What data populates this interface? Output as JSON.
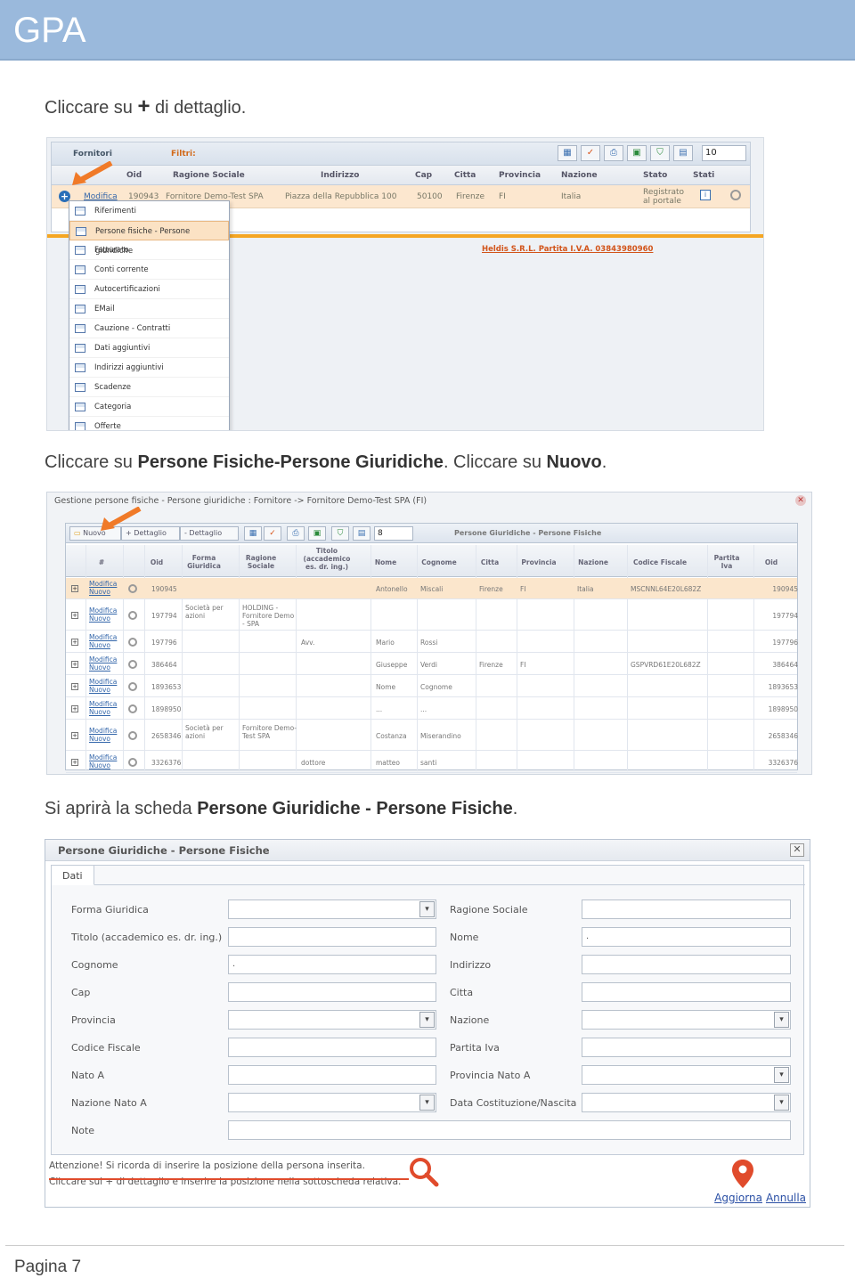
{
  "header": {
    "title": "GPA"
  },
  "instructions": {
    "step1_prefix": "Cliccare su ",
    "step1_plus": "+",
    "step1_suffix": " di dettaglio.",
    "step2_prefix": "Cliccare su ",
    "step2_bold1": "Persone Fisiche-Persone Giuridiche",
    "step2_mid": ". Cliccare su ",
    "step2_bold2": "Nuovo",
    "step2_end": ".",
    "step3_prefix": "Si aprirà la scheda ",
    "step3_bold": "Persone Giuridiche - Persone Fisiche",
    "step3_end": "."
  },
  "shot1": {
    "label_fornitori": "Fornitori",
    "label_filtri": "Filtri:",
    "page_size": "10",
    "columns": [
      "Oid",
      "Ragione Sociale",
      "Indirizzo",
      "Cap",
      "Citta",
      "Provincia",
      "Nazione",
      "Stato",
      "Stati"
    ],
    "row": {
      "action": "Modifica",
      "oid": "190943",
      "ragione": "Fornitore Demo-Test SPA",
      "indirizzo": "Piazza della Repubblica 100",
      "cap": "50100",
      "citta": "Firenze",
      "provincia": "FI",
      "nazione": "Italia",
      "stato_line1": "Registrato",
      "stato_line2": "al portale"
    },
    "footer_text": "Heldis S.R.L. Partita I.V.A. 03843980960",
    "menu": [
      "Riferimenti",
      "Persone fisiche - Persone giuridiche",
      "Fatturato",
      "Conti corrente",
      "Autocertificazioni",
      "EMail",
      "Cauzione - Contratti",
      "Dati aggiuntivi",
      "Indirizzi aggiuntivi",
      "Scadenze",
      "Categoria",
      "Offerte"
    ]
  },
  "shot2": {
    "window_title": "Gestione persone fisiche - Persone giuridiche : Fornitore -> Fornitore Demo-Test SPA (FI)",
    "btn_nuovo": "Nuovo",
    "btn_plus_dettaglio": "+ Dettaglio",
    "btn_minus_dettaglio": "- Dettaglio",
    "page_size": "8",
    "grid_title": "Persone Giuridiche - Persone Fisiche",
    "columns": [
      "#",
      "Oid",
      "Forma Giuridica",
      "Ragione Sociale",
      "Titolo (accademico es. dr. ing.)",
      "Nome",
      "Cognome",
      "Citta",
      "Provincia",
      "Nazione",
      "Codice Fiscale",
      "Partita Iva",
      "Oid"
    ],
    "link_modifica": "Modifica",
    "link_nuovo": "Nuovo",
    "rows": [
      {
        "oid": "190945",
        "forma": "",
        "ragione": "",
        "titolo": "",
        "nome": "Antonello",
        "cognome": "Miscali",
        "citta": "Firenze",
        "prov": "FI",
        "naz": "Italia",
        "cf": "MSCNNL64E20L682Z",
        "oid2": "190945"
      },
      {
        "oid": "197794",
        "forma": "Società per azioni",
        "ragione": "HOLDING - Fornitore Demo - SPA",
        "titolo": "",
        "nome": "",
        "cognome": "",
        "citta": "",
        "prov": "",
        "naz": "",
        "cf": "",
        "oid2": "197794"
      },
      {
        "oid": "197796",
        "forma": "",
        "ragione": "",
        "titolo": "Avv.",
        "nome": "Mario",
        "cognome": "Rossi",
        "citta": "",
        "prov": "",
        "naz": "",
        "cf": "",
        "oid2": "197796"
      },
      {
        "oid": "386464",
        "forma": "",
        "ragione": "",
        "titolo": "",
        "nome": "Giuseppe",
        "cognome": "Verdi",
        "citta": "Firenze",
        "prov": "FI",
        "naz": "",
        "cf": "GSPVRD61E20L682Z",
        "oid2": "386464"
      },
      {
        "oid": "1893653",
        "forma": "",
        "ragione": "",
        "titolo": "",
        "nome": "Nome",
        "cognome": "Cognome",
        "citta": "",
        "prov": "",
        "naz": "",
        "cf": "",
        "oid2": "1893653"
      },
      {
        "oid": "1898950",
        "forma": "",
        "ragione": "",
        "titolo": "",
        "nome": "...",
        "cognome": "...",
        "citta": "",
        "prov": "",
        "naz": "",
        "cf": "",
        "oid2": "1898950"
      },
      {
        "oid": "2658346",
        "forma": "Società per azioni",
        "ragione": "Fornitore Demo-Test SPA",
        "titolo": "",
        "nome": "Costanza",
        "cognome": "Miserandino",
        "citta": "",
        "prov": "",
        "naz": "",
        "cf": "",
        "oid2": "2658346"
      },
      {
        "oid": "3326376",
        "forma": "",
        "ragione": "",
        "titolo": "dottore",
        "nome": "matteo",
        "cognome": "santi",
        "citta": "",
        "prov": "",
        "naz": "",
        "cf": "",
        "oid2": "3326376"
      }
    ]
  },
  "shot3": {
    "title": "Persone Giuridiche - Persone Fisiche",
    "tab": "Dati",
    "left_labels": [
      "Forma Giuridica",
      "Titolo (accademico es. dr. ing.)",
      "Cognome",
      "Cap",
      "Provincia",
      "Codice Fiscale",
      "Nato A",
      "Nazione Nato A",
      "Note"
    ],
    "right_labels": [
      "Ragione Sociale",
      "Nome",
      "Indirizzo",
      "Citta",
      "Nazione",
      "Partita Iva",
      "Provincia Nato A",
      "Data Costituzione/Nascita"
    ],
    "nome_value": ".",
    "cognome_value": ".",
    "warning_line1": "Attenzione! Si ricorda di inserire la posizione della persona inserita.",
    "warning_line2": "Cliccare sul + di dettaglio e inserire la posizione nella sottoscheda relativa.",
    "btn_aggiorna": "Aggiorna",
    "btn_annulla": "Annulla"
  },
  "footer": {
    "page": "Pagina 7"
  }
}
